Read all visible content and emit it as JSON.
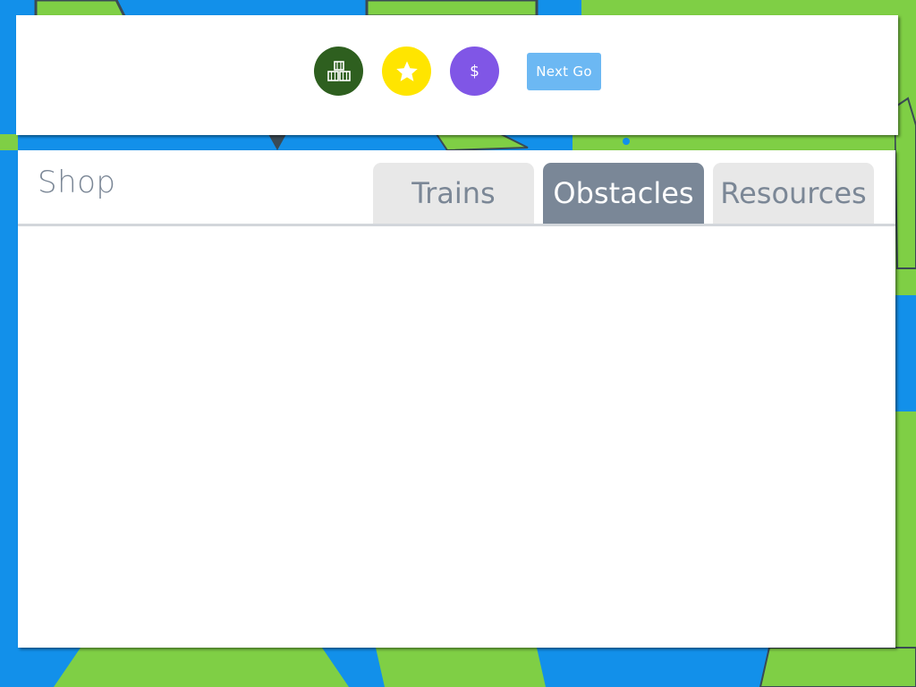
{
  "hud": {
    "goods_icon": "crates-icon",
    "score_icon": "star-icon",
    "money_symbol": "$",
    "next_go_label": "Next Go"
  },
  "shop": {
    "title": "Shop",
    "tabs": [
      {
        "label": "Trains",
        "active": false
      },
      {
        "label": "Obstacles",
        "active": true
      },
      {
        "label": "Resources",
        "active": false
      }
    ]
  },
  "colors": {
    "sea": "#1290ea",
    "land": "#7fcf45",
    "goods_button": "#2e5f1f",
    "score_button": "#ffe500",
    "money_button": "#8056e6",
    "next_go_button": "#6cb8f3",
    "active_tab": "#7a8797",
    "inactive_tab": "#e8e8e8"
  }
}
